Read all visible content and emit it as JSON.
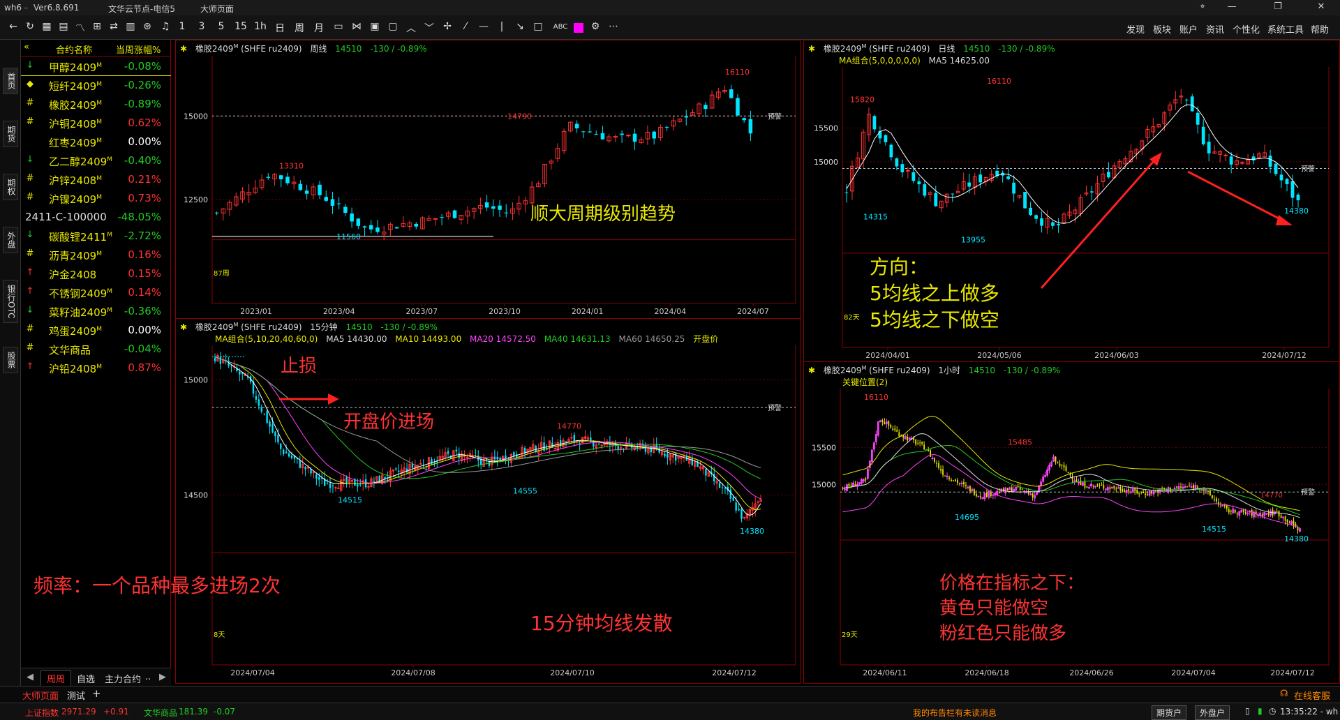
{
  "titlebar": {
    "app": "wh6",
    "version": "Ver6.8.691",
    "server": "文华云节点-电信5",
    "page": "大师页面"
  },
  "toolbar": {
    "periods": [
      "1",
      "3",
      "5",
      "15",
      "1h",
      "日",
      "周",
      "月"
    ],
    "abc": "ABC",
    "menus": [
      "发现",
      "板块",
      "账户",
      "资讯",
      "个性化",
      "系统工具",
      "帮助"
    ]
  },
  "rail": {
    "tabs": [
      "首页",
      "期货",
      "期权",
      "外盘",
      "银行OTC",
      "股票"
    ]
  },
  "watchlist": {
    "headers": [
      "合约名称",
      "当周涨幅%"
    ],
    "rows": [
      {
        "icon": "↓",
        "icolor": "#22cc22",
        "name": "甲醇2409",
        "sup": "M",
        "pct": "-0.08%",
        "color": "#22cc22"
      },
      {
        "icon": "◆",
        "icolor": "#e8e800",
        "name": "短纤2409",
        "sup": "M",
        "pct": "-0.26%",
        "color": "#22cc22"
      },
      {
        "icon": "#",
        "icolor": "#e8e800",
        "name": "橡胶2409",
        "sup": "M",
        "pct": "-0.89%",
        "color": "#22cc22"
      },
      {
        "icon": "#",
        "icolor": "#e8e800",
        "name": "沪铜2408",
        "sup": "M",
        "pct": "0.62%",
        "color": "#ff3333"
      },
      {
        "icon": "",
        "icolor": "#e8e800",
        "name": "红枣2409",
        "sup": "M",
        "pct": "0.00%",
        "color": "#ffffff"
      },
      {
        "icon": "↓",
        "icolor": "#22cc22",
        "name": "乙二醇2409",
        "sup": "M",
        "pct": "-0.40%",
        "color": "#22cc22"
      },
      {
        "icon": "#",
        "icolor": "#e8e800",
        "name": "沪锌2408",
        "sup": "M",
        "pct": "0.21%",
        "color": "#ff3333"
      },
      {
        "icon": "#",
        "icolor": "#e8e800",
        "name": "沪镍2409",
        "sup": "M",
        "pct": "0.73%",
        "color": "#ff3333"
      },
      {
        "icon": "",
        "icolor": "#e8e800",
        "name": "2411-C-100000",
        "sup": "",
        "pct": "-48.05%",
        "color": "#22cc22"
      },
      {
        "icon": "↓",
        "icolor": "#22cc22",
        "name": "碳酸锂2411",
        "sup": "M",
        "pct": "-2.72%",
        "color": "#22cc22"
      },
      {
        "icon": "#",
        "icolor": "#e8e800",
        "name": "沥青2409",
        "sup": "M",
        "pct": "0.16%",
        "color": "#ff3333"
      },
      {
        "icon": "↑",
        "icolor": "#ff3333",
        "name": "沪金2408",
        "sup": "",
        "pct": "0.15%",
        "color": "#ff3333"
      },
      {
        "icon": "↑",
        "icolor": "#ff3333",
        "name": "不锈钢2409",
        "sup": "M",
        "pct": "0.14%",
        "color": "#ff3333"
      },
      {
        "icon": "↓",
        "icolor": "#22cc22",
        "name": "菜籽油2409",
        "sup": "M",
        "pct": "-0.36%",
        "color": "#22cc22"
      },
      {
        "icon": "#",
        "icolor": "#e8e800",
        "name": "鸡蛋2409",
        "sup": "M",
        "pct": "0.00%",
        "color": "#ffffff"
      },
      {
        "icon": "#",
        "icolor": "#e8e800",
        "name": "文华商品",
        "sup": "",
        "pct": "-0.04%",
        "color": "#22cc22"
      },
      {
        "icon": "↑",
        "icolor": "#ff3333",
        "name": "沪铅2408",
        "sup": "M",
        "pct": "0.87%",
        "color": "#ff3333"
      }
    ],
    "footer": [
      "周周",
      "自选",
      "主力合约"
    ]
  },
  "panels": {
    "weekly": {
      "name": "橡胶2409",
      "sup": "M",
      "code": "(SHFE ru2409)",
      "period": "周线",
      "price": "14510",
      "chg": "-130 / -0.89%",
      "yticks": [
        "15000",
        "12500"
      ],
      "xticks": [
        "2023/01",
        "2023/04",
        "2023/07",
        "2023/10",
        "2024/01",
        "2024/04",
        "2024/07"
      ],
      "labels": {
        "hi": "16110",
        "mid1": "13310",
        "mid2": "14790",
        "lo": "11560",
        "bars": "87周",
        "alert": "预警"
      }
    },
    "daily": {
      "name": "橡胶2409",
      "sup": "M",
      "code": "(SHFE ru2409)",
      "period": "日线",
      "price": "14510",
      "chg": "-130 / -0.89%",
      "ma": "MA组合(5,0,0,0,0,0)",
      "ma5": "MA5 14625.00",
      "yticks": [
        "15500",
        "15000"
      ],
      "xticks": [
        "2024/04/01",
        "2024/05/06",
        "2024/06/03",
        "2024/07/12"
      ],
      "labels": {
        "hi": "16110",
        "h2": "15820",
        "l1": "14315",
        "l2": "13955",
        "l3": "14380",
        "bars": "82天",
        "alert": "预警"
      }
    },
    "m15": {
      "name": "橡胶2409",
      "sup": "M",
      "code": "(SHFE ru2409)",
      "period": "15分钟",
      "price": "14510",
      "chg": "-130 / -0.89%",
      "ma": "MA组合(5,10,20,40,60,0)",
      "ma5": "MA5 14430.00",
      "ma10": "MA10 14493.00",
      "ma20": "MA20 14572.50",
      "ma40": "MA40 14631.13",
      "ma60": "MA60 14650.25",
      "open": "开盘价",
      "yticks": [
        "15000",
        "14500"
      ],
      "xticks": [
        "2024/07/04",
        "2024/07/08",
        "2024/07/10",
        "2024/07/12"
      ],
      "labels": {
        "hi": "14770",
        "l1": "14515",
        "l2": "14555",
        "l3": "14380",
        "bars": "8天",
        "alert": "预警"
      }
    },
    "h1": {
      "name": "橡胶2409",
      "sup": "M",
      "code": "(SHFE ru2409)",
      "period": "1小时",
      "price": "14510",
      "chg": "-130 / -0.89%",
      "ind": "关键位置(2)",
      "yticks": [
        "15500",
        "15000"
      ],
      "xticks": [
        "2024/06/11",
        "2024/06/18",
        "2024/06/26",
        "2024/07/04",
        "2024/07/12"
      ],
      "labels": {
        "hi": "16110",
        "h2": "15485",
        "h3": "14770",
        "l1": "14695",
        "l2": "14515",
        "l3": "14380",
        "bars": "29天",
        "alert": "预警"
      }
    }
  },
  "annotations": {
    "trend": "顺大周期级别趋势",
    "stoploss": "止损",
    "openentry": "开盘价进场",
    "freq": "频率：一个品种最多进场2次",
    "m15diverge": "15分钟均线发散",
    "direction": [
      "方向：",
      "5均线之上做多",
      "5均线之下做空"
    ],
    "indicator": [
      "价格在指标之下：",
      "黄色只能做空",
      "粉红色只能做多"
    ]
  },
  "tabbar": {
    "tabs": [
      "大师页面",
      "测试"
    ],
    "add": "+",
    "right": "在线客服"
  },
  "statusbar": {
    "idx1_name": "上证指数",
    "idx1_val": "2971.29",
    "idx1_chg": "+0.91",
    "idx2_name": "文华商品",
    "idx2_val": "181.39",
    "idx2_chg": "-0.07",
    "notice": "我的布告栏有未读消息",
    "acct1": "期货户",
    "acct2": "外盘户",
    "time": "13:35:22 - wh"
  },
  "colors": {
    "up": "#ff3333",
    "down": "#00e5ff",
    "yellow": "#e8e800",
    "green": "#22cc22",
    "border": "#8b0000",
    "grid": "#5a0000"
  }
}
